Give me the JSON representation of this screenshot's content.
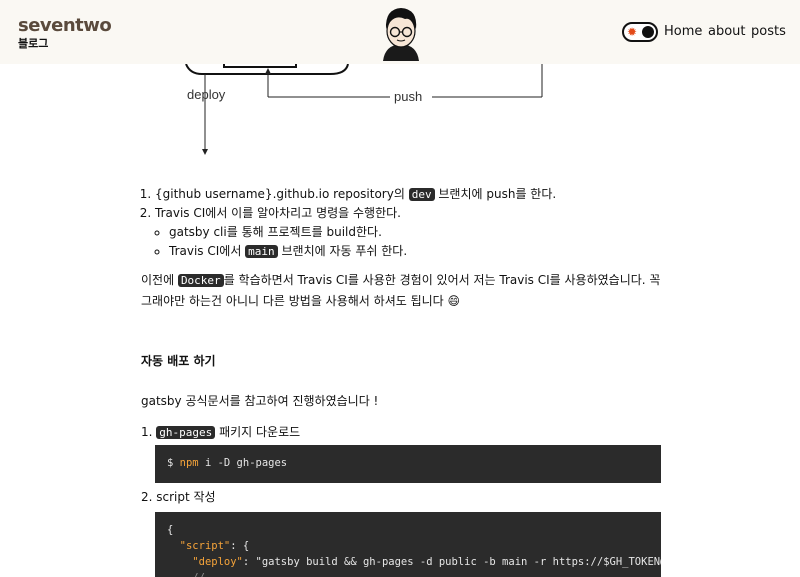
{
  "header": {
    "brand": "seventwo",
    "brand_sub": "블로그",
    "nav": [
      "Home",
      "about",
      "posts"
    ]
  },
  "diagram": {
    "deploy_label": "deploy",
    "push_label": "push"
  },
  "steps": {
    "item1_pre": "{github username}.github.io repository의 ",
    "item1_code": "dev",
    "item1_post": " 브랜치에 push를 한다.",
    "item2": "Travis CI에서 이를 알아차리고 명령을 수행한다.",
    "sub1": "gatsby cli를 통해 프로젝트를 build한다.",
    "sub2_pre": "Travis CI에서 ",
    "sub2_code": "main",
    "sub2_post": " 브랜치에 자동 푸쉬 한다."
  },
  "intro": {
    "pre": "이전에 ",
    "code": "Docker",
    "post": "를 학습하면서 Travis CI를 사용한 경험이 있어서 저는 Travis CI를 사용하였습니다. 꼭 그래야만 하는건 아니니 다른 방법을 사용해서 하셔도 됩니다 😄"
  },
  "section": {
    "title": "자동 배포 하기",
    "desc": "gatsby 공식문서를 참고하여 진행하였습니다 !",
    "step1_code": "gh-pages",
    "step1_post": " 패키지 다운로드",
    "cmd_prompt": "$ ",
    "cmd_npm": "npm",
    "cmd_rest": " i -D gh-pages",
    "step2": "script 작성",
    "json_open": "{",
    "json_script_key": "\"script\"",
    "json_script_rest": ": {",
    "json_deploy_key": "\"deploy\"",
    "json_deploy_rest": ": \"gatsby build && gh-pages -d public -b main -r https://$GH_TOKEN@github.com/",
    "json_comment": "//"
  }
}
